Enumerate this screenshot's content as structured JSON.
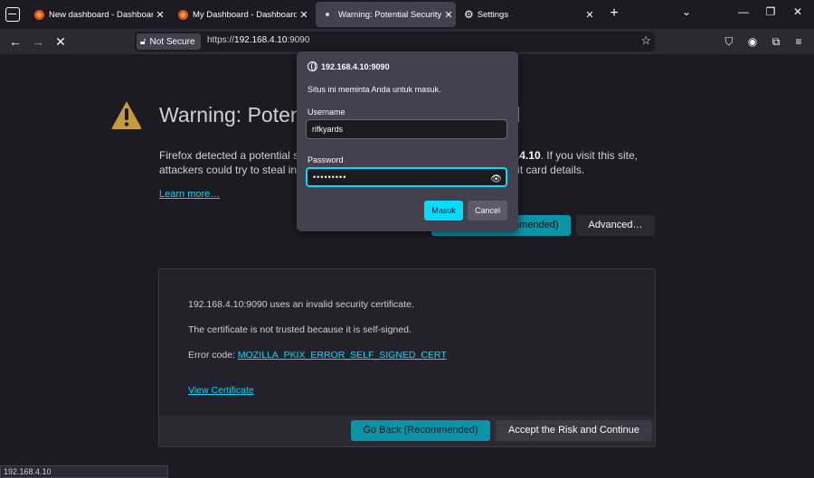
{
  "tabs": [
    {
      "title": "New dashboard - Dashboards - G",
      "close": "✕"
    },
    {
      "title": "My Dashboard - Dashboards - G",
      "close": "✕"
    },
    {
      "title": "Warning: Potential Security Risk",
      "close": "✕"
    },
    {
      "title": "Settings",
      "close": "✕"
    }
  ],
  "toolbar": {
    "not_secure_label": "Not Secure",
    "url_prefix": "https://",
    "url_host": "192.168.4.10",
    "url_port": ":9090"
  },
  "page": {
    "title": "Warning: Potential Security Risk Ahead",
    "description_start": "Firefox detected a potential security threat and did not continue to ",
    "description_host": "192.168.4.10",
    "description_end": ". If you visit this site, attackers could try to steal information like your passwords, emails, or credit card details.",
    "learn_more": "Learn more…",
    "go_back_top": "Go Back (Recommended)",
    "advanced": "Advanced…",
    "details": {
      "line1": "192.168.4.10:9090 uses an invalid security certificate.",
      "line2": "The certificate is not trusted because it is self-signed.",
      "error_prefix": "Error code: ",
      "error_code": "MOZILLA_PKIX_ERROR_SELF_SIGNED_CERT",
      "view_certificate": "View Certificate",
      "go_back": "Go Back (Recommended)",
      "accept": "Accept the Risk and Continue"
    }
  },
  "status_bar": "192.168.4.10",
  "auth_dialog": {
    "host": "192.168.4.10:9090",
    "message": "Situs ini meminta Anda untuk masuk.",
    "username_label": "Username",
    "username_value": "rifkyards",
    "password_label": "Password",
    "password_value": "•••••••••",
    "submit_label": "Masuk",
    "cancel_label": "Cancel"
  },
  "colors": {
    "accent": "#00ddff",
    "button_primary": "#0b94a8",
    "warning_icon": "#c49a3a"
  }
}
